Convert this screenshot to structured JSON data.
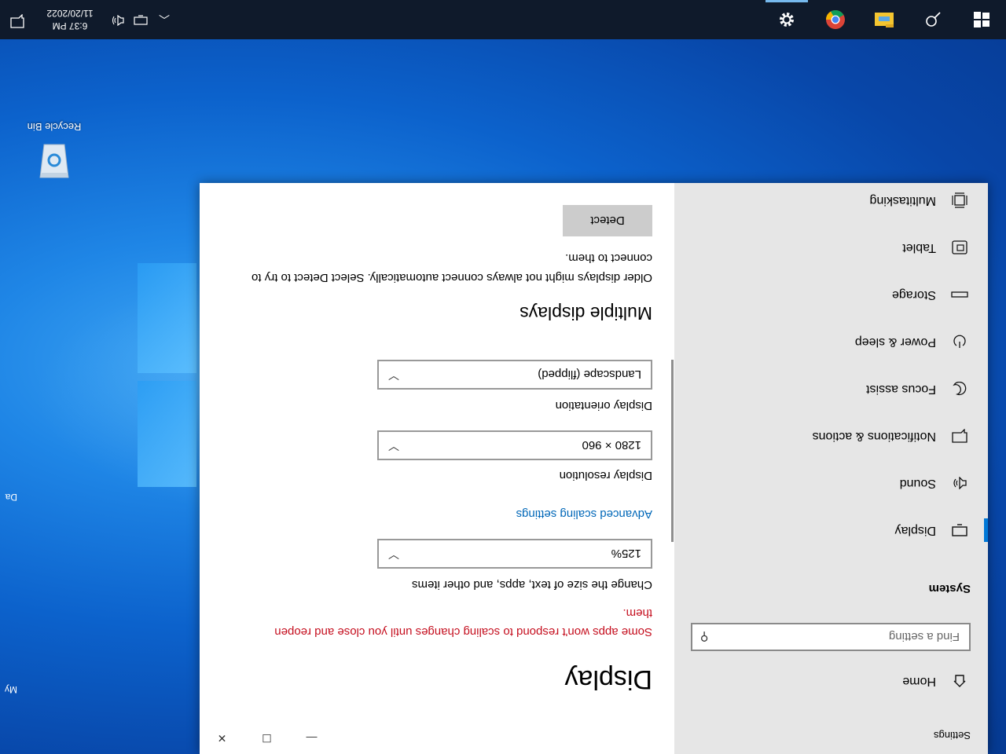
{
  "desktop": {
    "recycle_bin_label": "Recycle Bin",
    "edge_labels": [
      "My",
      "Da"
    ]
  },
  "settings": {
    "window_title": "Settings",
    "window_controls": {
      "minimize": "—",
      "maximize": "☐",
      "close": "✕"
    },
    "home_label": "Home",
    "search_placeholder": "Find a setting",
    "group_title": "System",
    "nav": [
      {
        "label": "Display",
        "icon": "monitor-icon",
        "active": true
      },
      {
        "label": "Sound",
        "icon": "speaker-icon"
      },
      {
        "label": "Notifications & actions",
        "icon": "notification-icon"
      },
      {
        "label": "Focus assist",
        "icon": "moon-icon"
      },
      {
        "label": "Power & sleep",
        "icon": "power-icon"
      },
      {
        "label": "Storage",
        "icon": "storage-icon"
      },
      {
        "label": "Tablet",
        "icon": "tablet-icon"
      },
      {
        "label": "Multitasking",
        "icon": "multitasking-icon"
      }
    ],
    "display": {
      "title": "Display",
      "warning": "Some apps won't respond to scaling changes until you close and reopen them.",
      "scale_label": "Change the size of text, apps, and other items",
      "scale_value": "125%",
      "advanced_link": "Advanced scaling settings",
      "resolution_label": "Display resolution",
      "resolution_value": "1280 × 960",
      "orientation_label": "Display orientation",
      "orientation_value": "Landscape (flipped)",
      "multiple_title": "Multiple displays",
      "multiple_desc": "Older displays might not always connect automatically. Select Detect to try to connect to them.",
      "detect_button": "Detect"
    }
  },
  "taskbar": {
    "time": "6:37 PM",
    "date": "11/20/2022",
    "apps": [
      "start-icon",
      "search-icon",
      "file-explorer-icon",
      "chrome-icon",
      "settings-icon"
    ]
  },
  "colors": {
    "accent": "#0078d7",
    "warning": "#c50f1f",
    "link": "#0067b8",
    "taskbar": "#0f1a2b"
  }
}
